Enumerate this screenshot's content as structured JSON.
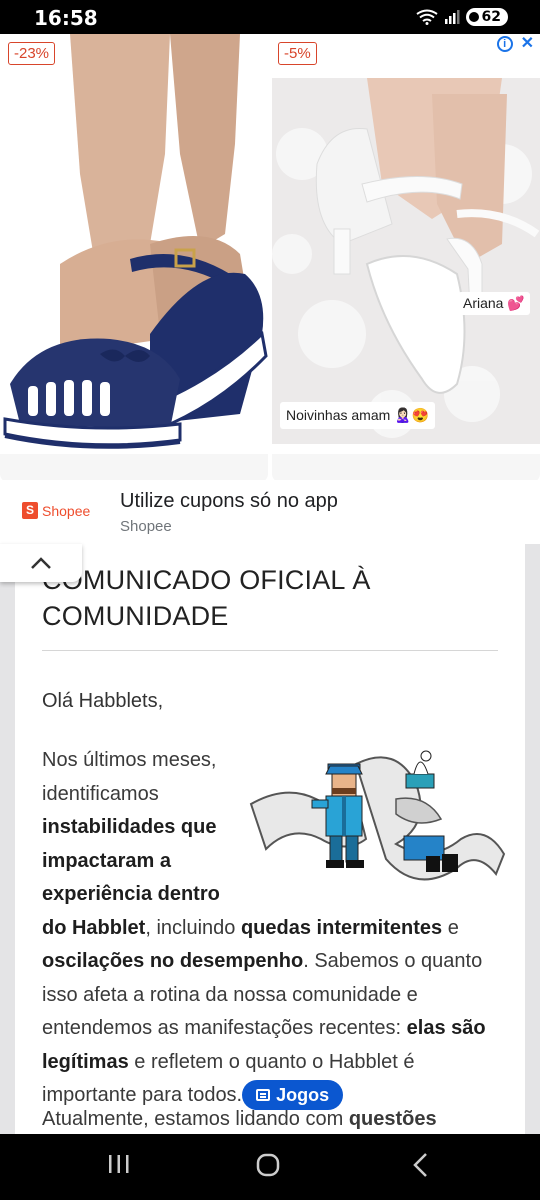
{
  "status_bar": {
    "time": "16:58",
    "battery": "62",
    "icons": [
      "wifi-icon",
      "signal-icon",
      "battery-icon"
    ]
  },
  "ad": {
    "left_product": {
      "discount": "-23%"
    },
    "right_product": {
      "discount": "-5%",
      "caption_name": "Ariana 💕",
      "caption_tagline": "Noivinhas amam 🙎🏻‍♀️😍"
    },
    "title": "Utilize cupons só no app",
    "advertiser": "Shopee",
    "logo_text": "Shopee",
    "brand_color": "#ee4d2d"
  },
  "article": {
    "title": "COMUNICADO OFICIAL À COMUNIDADE",
    "greeting": "Olá Habblets,",
    "p1": {
      "t1": "Nos últimos meses, identificamos ",
      "b1": "instabilidades que impactaram a experiência dentro do Habblet",
      "t2": ", incluindo ",
      "b2": "quedas intermitentes",
      "t3": " e ",
      "b3": "oscilações no desempenho",
      "t4": ". Sabemos o quanto isso afeta a rotina da nossa comunidade e entendemos as manifestações recentes: ",
      "b4": "elas são legítimas",
      "t5": " e refletem o quanto o Habblet é importante para todos."
    },
    "tag_label": "Jogos",
    "tag_color": "#0b57d0",
    "p2_start": "Atualmente, estamos lidando com ",
    "p2_bold": "questões"
  }
}
